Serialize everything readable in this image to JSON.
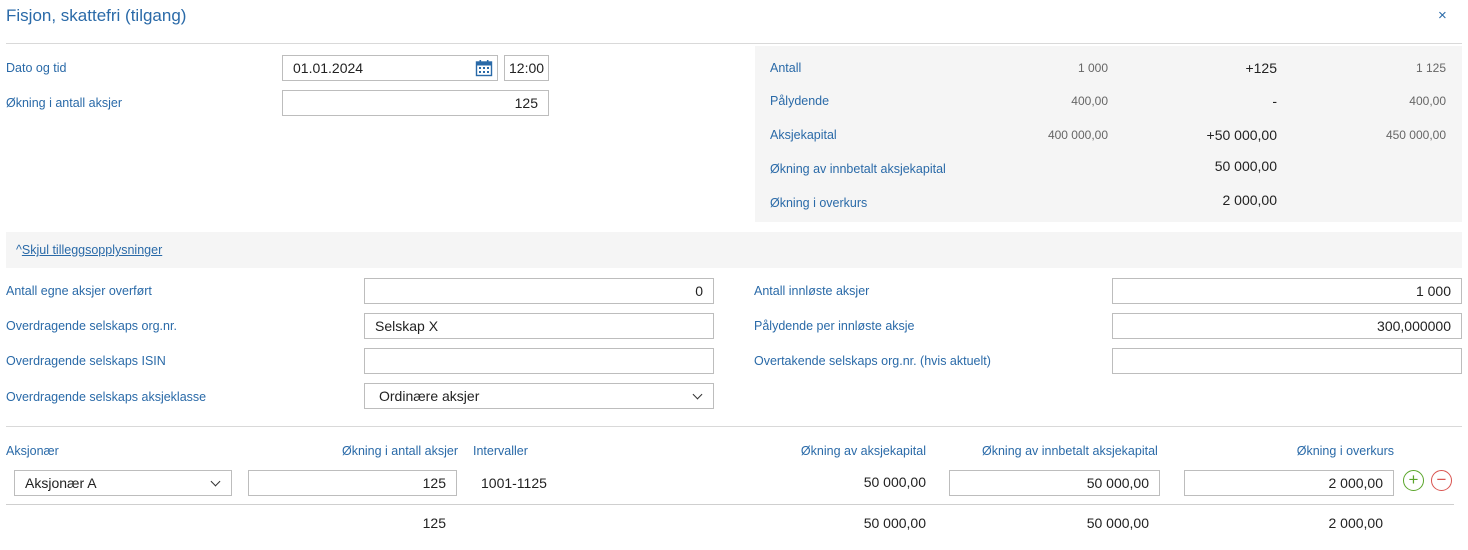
{
  "dialog": {
    "title": "Fisjon, skattefri (tilgang)",
    "close_icon": "×"
  },
  "form": {
    "date_label": "Dato og tid",
    "date_value": "01.01.2024",
    "time_value": "12:00",
    "increase_shares_label": "Økning i antall aksjer",
    "increase_shares_value": "125"
  },
  "summary": {
    "rows": [
      {
        "label": "Antall",
        "before": "1 000",
        "change": "+125",
        "after": "1 125"
      },
      {
        "label": "Pålydende",
        "before": "400,00",
        "change": "-",
        "after": "400,00"
      },
      {
        "label": "Aksjekapital",
        "before": "400 000,00",
        "change": "+50 000,00",
        "after": "450 000,00"
      },
      {
        "label": "Økning av innbetalt aksjekapital",
        "change": "50 000,00"
      },
      {
        "label": "Økning i overkurs",
        "change": "2 000,00"
      }
    ]
  },
  "toggle": {
    "caret": "^",
    "label": "Skjul tilleggsopplysninger"
  },
  "extra": {
    "own_shares_label": "Antall egne aksjer overført",
    "own_shares_value": "0",
    "org_nr_label": "Overdragende selskaps org.nr.",
    "org_nr_value": "Selskap X",
    "isin_label": "Overdragende selskaps ISIN",
    "isin_value": "",
    "share_class_label": "Overdragende selskaps aksjeklasse",
    "share_class_value": "Ordinære aksjer",
    "redeemed_label": "Antall innløste aksjer",
    "redeemed_value": "1 000",
    "par_redeemed_label": "Pålydende per innløste aksje",
    "par_redeemed_value": "300,000000",
    "acquiring_org_label": "Overtakende selskaps org.nr. (hvis aktuelt)",
    "acquiring_org_value": ""
  },
  "shareholders": {
    "headers": {
      "shareholder": "Aksjonær",
      "increase_shares": "Økning i antall aksjer",
      "intervals": "Intervaller",
      "increase_capital": "Økning av aksjekapital",
      "increase_paid_capital": "Økning av innbetalt aksjekapital",
      "increase_premium": "Økning i overkurs"
    },
    "rows": [
      {
        "shareholder": "Aksjonær A",
        "increase_shares": "125",
        "intervals": "1001-1125",
        "increase_capital": "50 000,00",
        "increase_paid_capital": "50 000,00",
        "increase_premium": "2 000,00"
      }
    ],
    "totals": {
      "increase_shares": "125",
      "increase_capital": "50 000,00",
      "increase_paid_capital": "50 000,00",
      "increase_premium": "2 000,00"
    },
    "add_icon": "+",
    "remove_icon": "−",
    "add_color": "#5aa52a",
    "remove_color": "#d9534f"
  },
  "colors": {
    "accent": "#2a6aa8",
    "panel": "#f5f5f5",
    "border": "#bdbdbd"
  }
}
